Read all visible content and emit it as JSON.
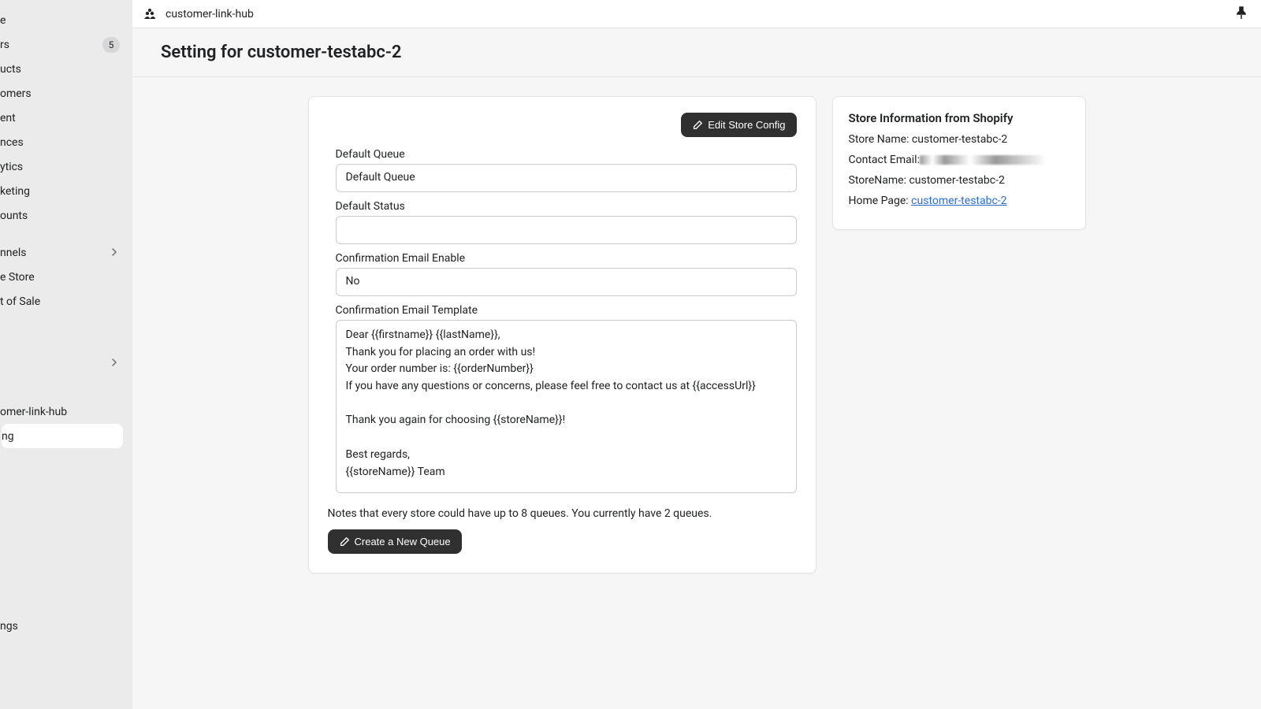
{
  "topbar": {
    "app_name": "customer-link-hub"
  },
  "sidebar": {
    "items": [
      {
        "label": "e",
        "badge": null
      },
      {
        "label": "rs",
        "badge": "5"
      },
      {
        "label": "ucts",
        "badge": null
      },
      {
        "label": "omers",
        "badge": null
      },
      {
        "label": "ent",
        "badge": null
      },
      {
        "label": "nces",
        "badge": null
      },
      {
        "label": "ytics",
        "badge": null
      },
      {
        "label": "keting",
        "badge": null
      },
      {
        "label": "ounts",
        "badge": null
      }
    ],
    "section2": [
      {
        "label": "nnels",
        "chevron": true
      },
      {
        "label": "e Store",
        "chevron": false
      },
      {
        "label": "t of Sale",
        "chevron": false
      },
      {
        "label": "",
        "chevron": false
      }
    ],
    "section3": [
      {
        "label": "",
        "chevron": true
      },
      {
        "label": "",
        "chevron": false
      },
      {
        "label": "omer-link-hub",
        "chevron": false
      },
      {
        "label": "ng",
        "chevron": false,
        "active": true
      }
    ],
    "bottom": {
      "label": "ngs"
    }
  },
  "page": {
    "title": "Setting for customer-testabc-2"
  },
  "main_card": {
    "edit_btn": "Edit Store Config",
    "labels": {
      "default_queue": "Default Queue",
      "default_status": "Default Status",
      "conf_email_enable": "Confirmation Email Enable",
      "conf_email_template": "Confirmation Email Template"
    },
    "values": {
      "default_queue": "Default Queue",
      "default_status": "",
      "conf_email_enable": "No",
      "conf_email_template": "Dear {{firstname}} {{lastName}},\nThank you for placing an order with us!\nYour order number is: {{orderNumber}}\nIf you have any questions or concerns, please feel free to contact us at {{accessUrl}}\n\nThank you again for choosing {{storeName}}!\n\nBest regards,\n{{storeName}} Team"
    },
    "note": "Notes that every store could have up to 8 queues. You currently have 2 queues.",
    "create_btn": "Create a New Queue"
  },
  "side_card": {
    "title": "Store Information from Shopify",
    "rows": {
      "store_name_label": "Store Name: ",
      "store_name_value": "customer-testabc-2",
      "contact_email_label": "Contact Email:",
      "storename2_label": "StoreName: ",
      "storename2_value": "customer-testabc-2",
      "home_page_label": "Home Page: ",
      "home_page_link": "customer-testabc-2"
    }
  }
}
